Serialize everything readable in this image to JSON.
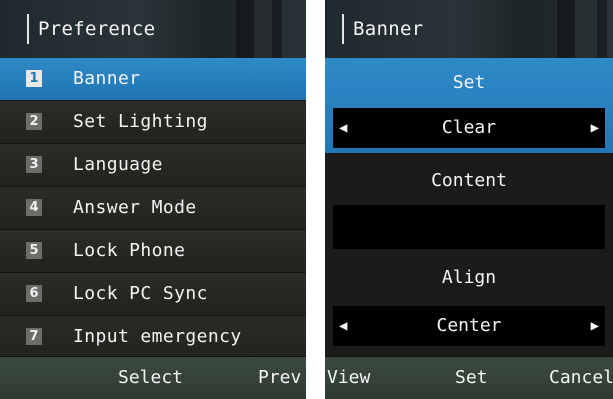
{
  "left": {
    "title": "Preference",
    "menu": [
      {
        "num": "1",
        "label": "Banner",
        "selected": true
      },
      {
        "num": "2",
        "label": "Set Lighting",
        "selected": false
      },
      {
        "num": "3",
        "label": "Language",
        "selected": false
      },
      {
        "num": "4",
        "label": "Answer Mode",
        "selected": false
      },
      {
        "num": "5",
        "label": "Lock Phone",
        "selected": false
      },
      {
        "num": "6",
        "label": "Lock PC Sync",
        "selected": false
      },
      {
        "num": "7",
        "label": "Input emergency",
        "selected": false
      }
    ],
    "softkeys": {
      "center": "Select",
      "right": "Prev"
    }
  },
  "right": {
    "title": "Banner",
    "set": {
      "label": "Set",
      "value": "Clear"
    },
    "content": {
      "label": "Content",
      "value": ""
    },
    "align": {
      "label": "Align",
      "value": "Center"
    },
    "softkeys": {
      "left": "View",
      "center": "Set",
      "right": "Cancel"
    }
  },
  "colors": {
    "accent": "#2a80c0",
    "background": "#1b1b19",
    "softbar": "#34433a"
  },
  "icons": {
    "left_arrow": "◀",
    "right_arrow": "▶"
  }
}
